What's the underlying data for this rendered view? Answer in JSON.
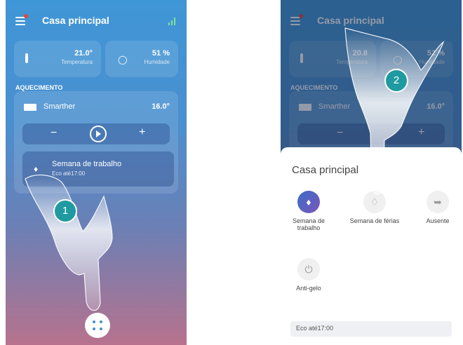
{
  "left": {
    "title": "Casa principal",
    "temperature": {
      "value": "21.0°",
      "label": "Temperatura"
    },
    "humidity": {
      "value": "51 %",
      "label": "Humidade"
    },
    "section": "AQUECIMENTO",
    "device": {
      "name": "Smarther",
      "temp": "16.0°"
    },
    "controls": {
      "minus": "−",
      "plus": "+"
    },
    "program": {
      "name": "Semana de trabalho",
      "detail": "Eco até17:00"
    },
    "step": "1"
  },
  "right": {
    "title": "Casa principal",
    "temperature": {
      "value": "20.8",
      "label": "Temperatura"
    },
    "humidity": {
      "value": "52 %",
      "label": "Humidade"
    },
    "section": "AQUECIMENTO",
    "device": {
      "name": "Smarther",
      "temp": "16.0°"
    },
    "controls": {
      "minus": "−",
      "plus": "+"
    },
    "sheet": {
      "title": "Casa principal",
      "modes": [
        {
          "label": "Semana de trabalho"
        },
        {
          "label": "Semana de férias"
        },
        {
          "label": "Ausente"
        },
        {
          "label": "Anti-gelo"
        }
      ],
      "status": "Eco até17:00"
    },
    "step": "2"
  }
}
